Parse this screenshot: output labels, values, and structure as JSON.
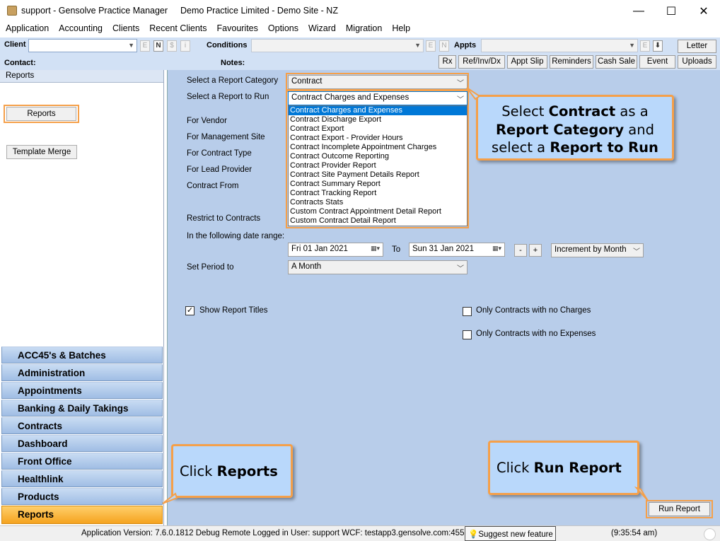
{
  "window": {
    "title": "support - Gensolve Practice Manager",
    "practice": "Demo Practice Limited  - Demo Site - NZ",
    "minimize": "—",
    "maximize": "☐",
    "close": "✕"
  },
  "menu": [
    "Application",
    "Accounting",
    "Clients",
    "Recent Clients",
    "Favourites",
    "Options",
    "Wizard",
    "Migration",
    "Help"
  ],
  "toolbar": {
    "client_label": "Client",
    "conditions_label": "Conditions",
    "appts_label": "Appts",
    "letter": "Letter",
    "contact_label": "Contact:",
    "notes_label": "Notes:",
    "mini_buttons": [
      "E",
      "N",
      "$",
      "i"
    ],
    "cond_buttons": [
      "E",
      "N"
    ],
    "appt_buttons": [
      "E",
      "⬇"
    ],
    "buttons": [
      "Rx",
      "Ref/Inv/Dx",
      "Appt Slip",
      "Reminders",
      "Cash Sale",
      "Event",
      "Uploads"
    ]
  },
  "left_panel": {
    "header": "Reports",
    "reports_button": "Reports",
    "template_merge_button": "Template Merge",
    "nav": [
      "ACC45's & Batches",
      "Administration",
      "Appointments",
      "Banking & Daily Takings",
      "Contracts",
      "Dashboard",
      "Front Office",
      "Healthlink",
      "Products",
      "Reports"
    ]
  },
  "form": {
    "category_label": "Select a Report Category",
    "category_value": "Contract",
    "report_label": "Select a Report to Run",
    "report_value": "Contract Charges and Expenses",
    "report_options": [
      "Contract Charges and Expenses",
      "Contract Discharge Export",
      "Contract Export",
      "Contract Export - Provider Hours",
      "Contract Incomplete Appointment Charges",
      "Contract Outcome Reporting",
      "Contract Provider Report",
      "Contract Site Payment Details Report",
      "Contract Summary Report",
      "Contract Tracking Report",
      "Contracts Stats",
      "Custom Contract Appointment Detail Report",
      "Custom Contract Detail Report"
    ],
    "for_vendor": "For Vendor",
    "for_management_site": "For Management Site",
    "for_contract_type": "For Contract Type",
    "for_lead_provider": "For Lead Provider",
    "contract_from": "Contract From",
    "restrict_to_contracts": "Restrict to Contracts",
    "date_range_label": "In the following date range:",
    "from_date": "Fri   01 Jan  2021",
    "to_label": "To",
    "to_date": "Sun  31 Jan  2021",
    "minus": "-",
    "plus": "+",
    "increment_value": "Increment by Month",
    "period_label": "Set Period to",
    "period_value": "A Month",
    "show_titles_label": "Show Report Titles",
    "show_titles_checked": "✓",
    "no_charges_label": "Only Contracts with no Charges",
    "no_expenses_label": "Only Contracts with no Expenses",
    "run_report": "Run Report"
  },
  "callouts": {
    "select_line1_a": "Select ",
    "select_line1_b": "Contract",
    "select_line1_c": " as a",
    "select_line2_a": "Report Category",
    "select_line2_b": " and",
    "select_line3_a": "select a ",
    "select_line3_b": "Report to Run",
    "click_reports_a": "Click ",
    "click_reports_b": "Reports",
    "click_run_a": "Click ",
    "click_run_b": "Run Report"
  },
  "status": {
    "version": "Application Version: 7.6.0.1812 Debug Remote  Logged in User: support WCF: testapp3.gensolve.com:4551",
    "suggest": "Suggest new feature",
    "time": "(9:35:54 am)"
  },
  "colors": {
    "accent_orange": "#f5a04a",
    "callout_bg": "#b9d8fb",
    "nav_active": "#f5a31f",
    "main_bg": "#b8cdea",
    "highlight": "#0078d7"
  }
}
